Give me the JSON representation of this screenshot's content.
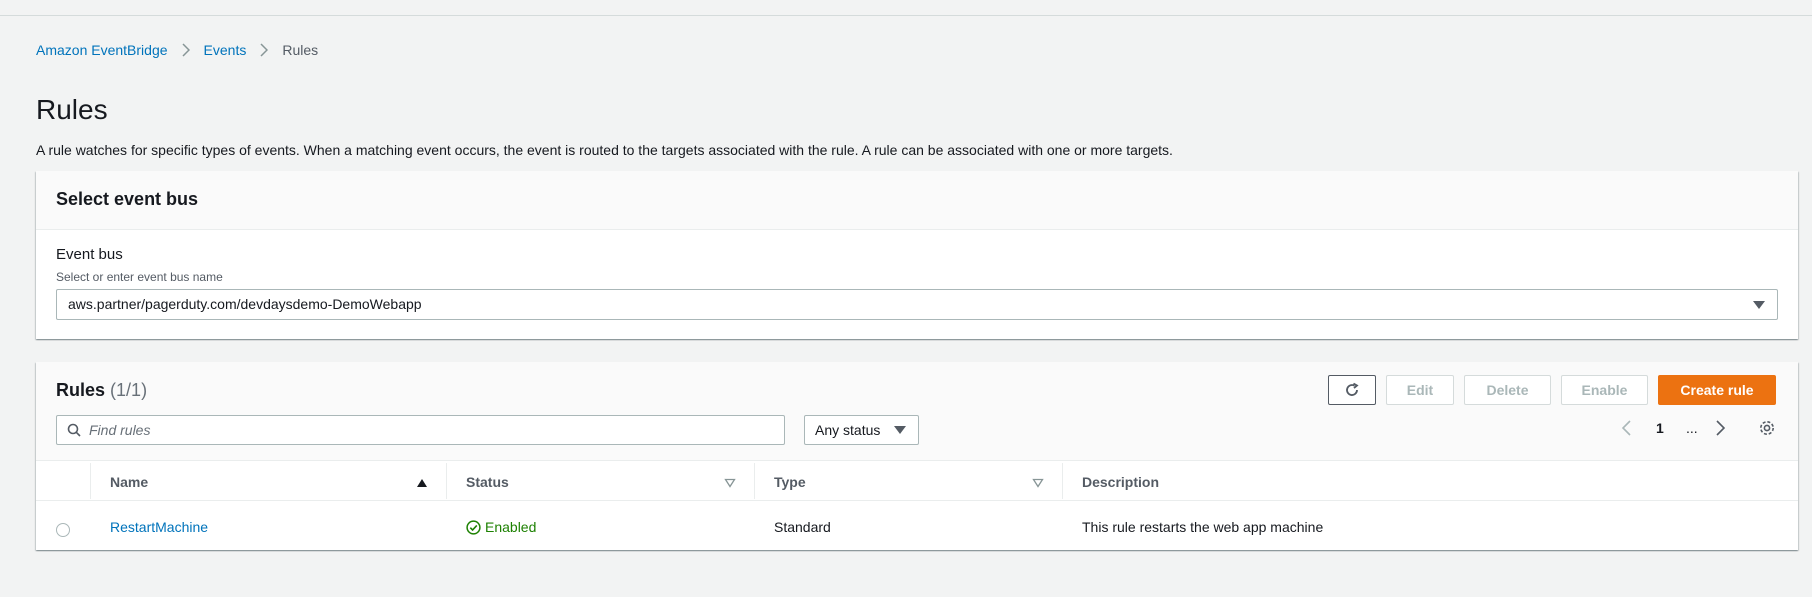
{
  "breadcrumb": {
    "items": [
      "Amazon EventBridge",
      "Events",
      "Rules"
    ]
  },
  "page": {
    "title": "Rules",
    "description": "A rule watches for specific types of events. When a matching event occurs, the event is routed to the targets associated with the rule. A rule can be associated with one or more targets."
  },
  "event_bus_panel": {
    "header": "Select event bus",
    "field_label": "Event bus",
    "field_hint": "Select or enter event bus name",
    "selected_value": "aws.partner/pagerduty.com/devdaysdemo-DemoWebapp"
  },
  "rules_panel": {
    "title": "Rules",
    "count": "(1/1)",
    "buttons": {
      "edit": "Edit",
      "delete": "Delete",
      "enable": "Enable",
      "create": "Create rule"
    },
    "search_placeholder": "Find rules",
    "status_filter": "Any status",
    "pagination": {
      "current_page": "1",
      "ellipsis": "..."
    },
    "columns": [
      "Name",
      "Status",
      "Type",
      "Description"
    ],
    "rows": [
      {
        "name": "RestartMachine",
        "status": "Enabled",
        "type": "Standard",
        "description": "This rule restarts the web app machine"
      }
    ]
  },
  "colors": {
    "link": "#0073bb",
    "primary_button": "#ec7211",
    "success": "#1d8102"
  }
}
